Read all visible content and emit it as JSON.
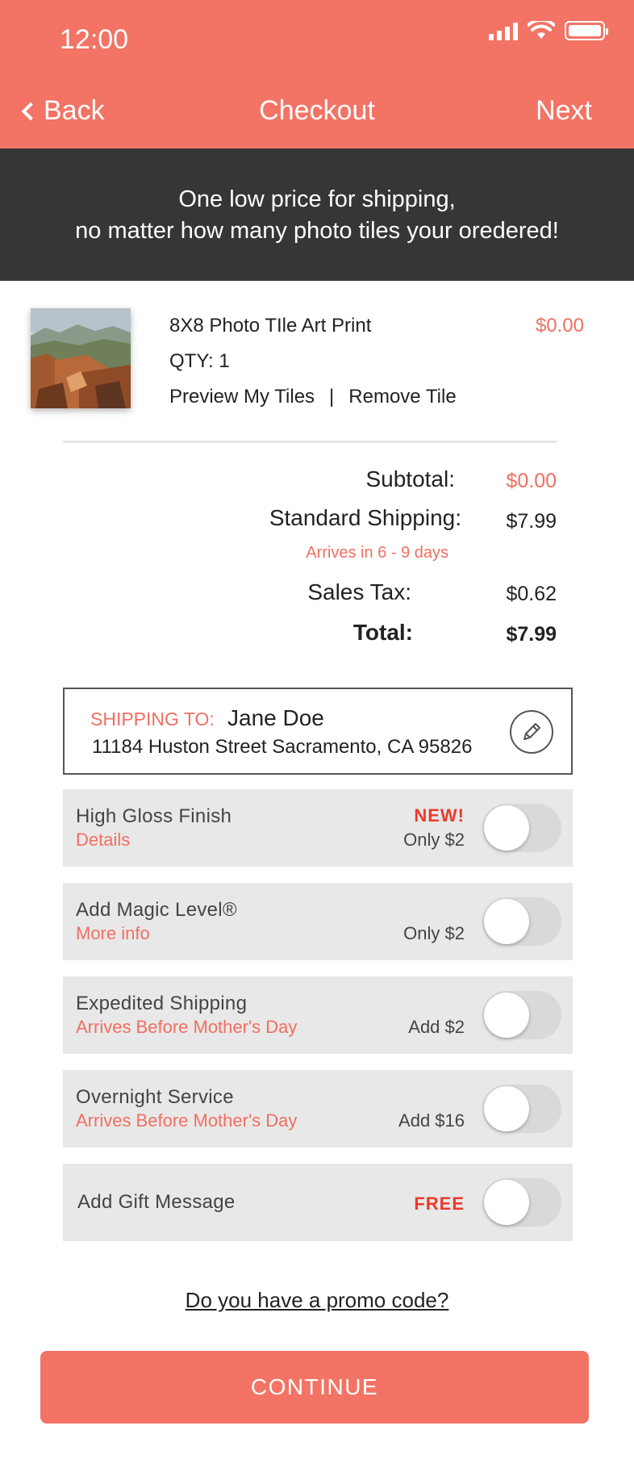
{
  "status_bar": {
    "time": "12:00"
  },
  "nav": {
    "back_label": "Back",
    "title": "Checkout",
    "next_label": "Next"
  },
  "banner": {
    "line1": "One low price for shipping,",
    "line2": "no matter how many photo tiles your oredered!"
  },
  "item": {
    "name": "8X8 Photo TIle Art Print",
    "price": "$0.00",
    "qty": "QTY: 1",
    "preview_link": "Preview My Tiles",
    "separator": "|",
    "remove_link": "Remove Tile"
  },
  "summary": {
    "subtotal_label": "Subtotal:",
    "subtotal_value": "$0.00",
    "shipping_label": "Standard Shipping:",
    "shipping_value": "$7.99",
    "arrives": "Arrives in 6 - 9 days",
    "tax_label": "Sales Tax:",
    "tax_value": "$0.62",
    "total_label": "Total:",
    "total_value": "$7.99"
  },
  "shipping": {
    "label": "SHIPPING TO:",
    "name": "Jane Doe",
    "address": "11184 Huston Street Sacramento, CA 95826"
  },
  "options": [
    {
      "title": "High Gloss Finish",
      "sub": "Details",
      "badge": "NEW!",
      "price": "Only $2",
      "enabled": false
    },
    {
      "title": "Add Magic Level®",
      "sub": "More info",
      "price": "Only $2",
      "enabled": false
    },
    {
      "title": "Expedited Shipping",
      "sub": "Arrives Before Mother's Day",
      "price": "Add $2",
      "enabled": false
    },
    {
      "title": "Overnight Service",
      "sub": "Arrives Before Mother's Day",
      "price": "Add $16",
      "enabled": false
    },
    {
      "title": "Add Gift Message",
      "price": "FREE",
      "enabled": false
    }
  ],
  "promo_link": "Do you have a promo code?",
  "continue_label": "CONTINUE",
  "colors": {
    "accent": "#f37365",
    "banner": "#363636",
    "option_bg": "#e8e8e8",
    "link": "#f06f62"
  }
}
